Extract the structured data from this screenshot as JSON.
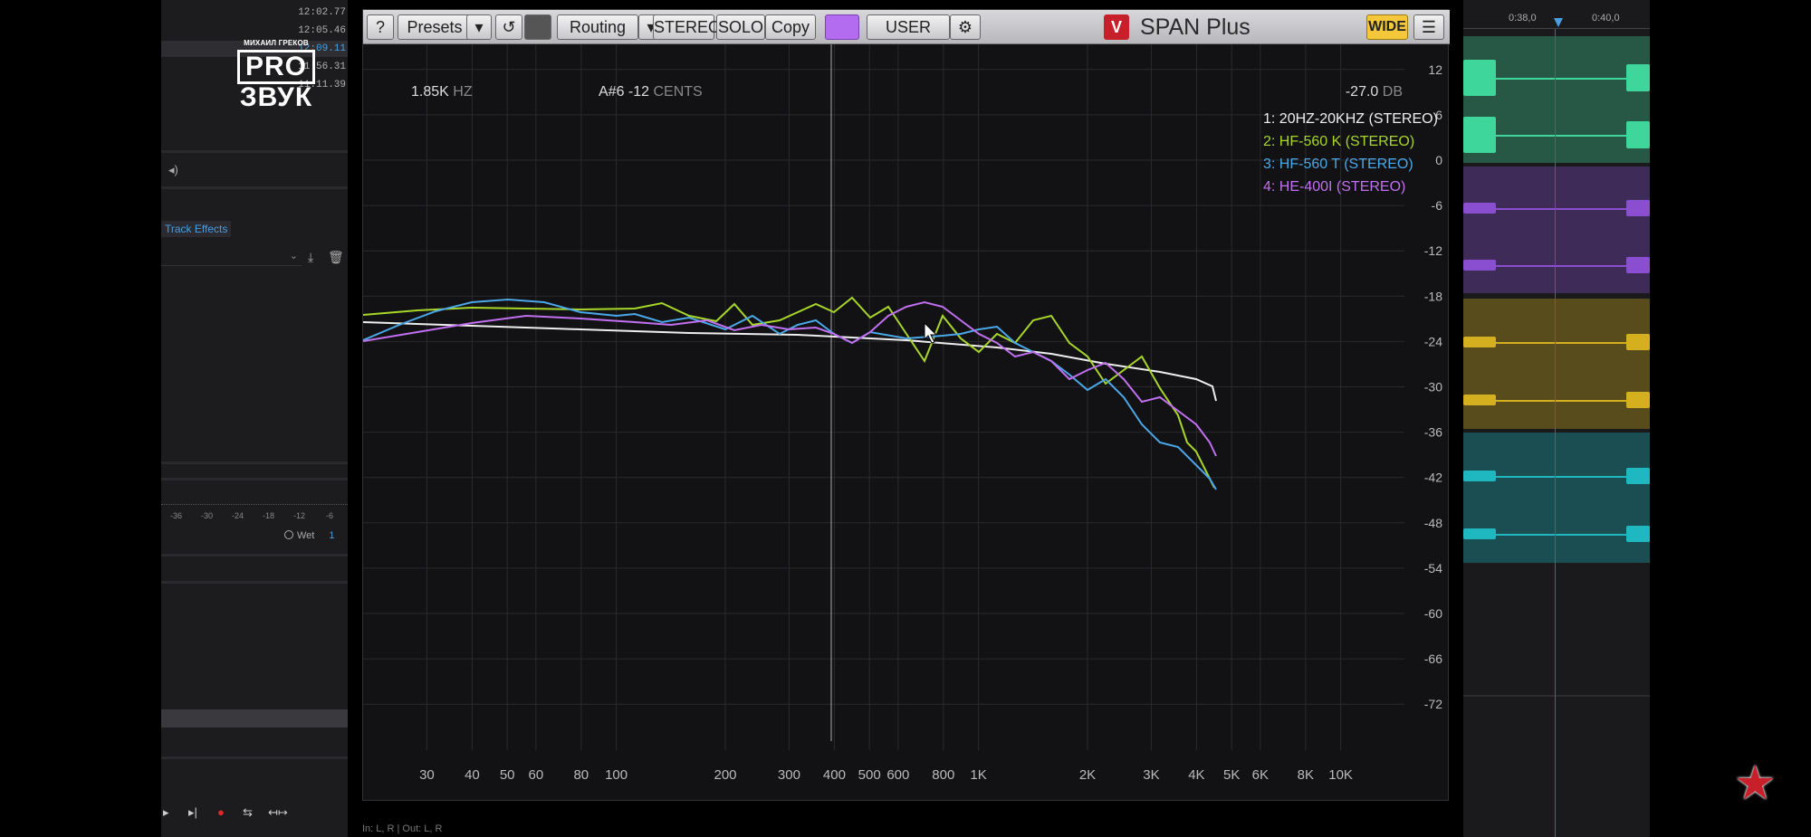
{
  "daw_left": {
    "timestamps": [
      "12:02.77",
      "12:05.46",
      "12:09.11",
      "11:56.31",
      "11:11.39"
    ],
    "selected_index": 2,
    "logo": {
      "author": "МИХАИЛ ГРЕКОВ",
      "pro": "PRO",
      "zvuk": "ЗВУК"
    },
    "track_effects_label": "Track Effects",
    "meter_scale": [
      "-36",
      "-30",
      "-24",
      "-18",
      "-12",
      "-6"
    ],
    "wet_label": "Wet",
    "wet_value": "1",
    "io_status": "In: L, R | Out: L, R"
  },
  "plugin": {
    "toolbar": {
      "help": "?",
      "presets": "Presets",
      "routing": "Routing",
      "stereo": "STEREO",
      "solo": "SOLO",
      "copy": "Copy",
      "user": "USER",
      "wide": "WIDE",
      "title": "SPAN Plus",
      "logo_mark": "V"
    },
    "readout": {
      "freq": "1.85K",
      "freq_unit": "HZ",
      "note": "A#6  -12",
      "note_unit": "CENTS",
      "db": "-27.0",
      "db_unit": "DB"
    },
    "legend": [
      {
        "label": "1: 20HZ-20KHZ (STEREO)",
        "color": "#eeeeee"
      },
      {
        "label": "2: HF-560 K (STEREO)",
        "color": "#a8d62a"
      },
      {
        "label": "3: HF-560 T (STEREO)",
        "color": "#4aa8e8"
      },
      {
        "label": "4: HE-400I (STEREO)",
        "color": "#c070f0"
      }
    ],
    "freq_ticks": [
      "30",
      "40",
      "50",
      "60",
      "80",
      "100",
      "200",
      "300",
      "400",
      "500",
      "600",
      "800",
      "1K",
      "2K",
      "3K",
      "4K",
      "5K",
      "6K",
      "8K",
      "10K"
    ],
    "db_ticks": [
      "12",
      "6",
      "0",
      "-6",
      "-12",
      "-18",
      "-24",
      "-30",
      "-36",
      "-42",
      "-48",
      "-54",
      "-60",
      "-66",
      "-72"
    ]
  },
  "daw_right": {
    "ruler": [
      "0:38,0",
      "0:40,0"
    ],
    "track_colors": [
      "#3ed69a",
      "#8a4ed0",
      "#d4b020",
      "#1fb8c0"
    ]
  }
}
